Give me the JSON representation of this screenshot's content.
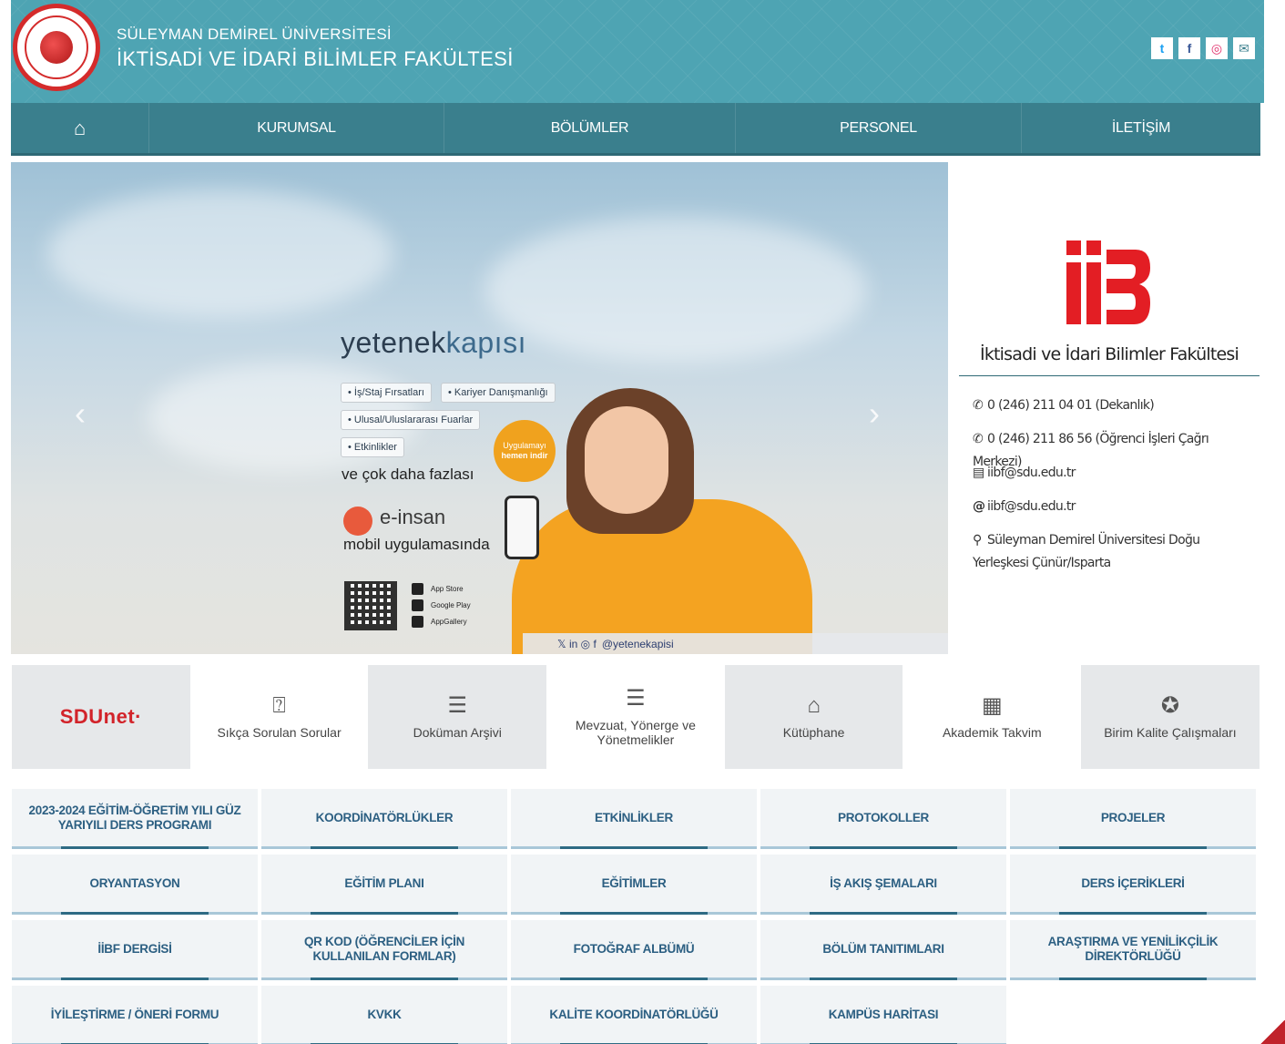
{
  "header": {
    "university": "SÜLEYMAN DEMİREL ÜNİVERSİTESİ",
    "faculty": "İKTİSADİ VE İDARİ BİLİMLER FAKÜLTESİ",
    "social": [
      {
        "icon": "twitter-icon",
        "glyph": "t",
        "color": "#1da1f2"
      },
      {
        "icon": "facebook-icon",
        "glyph": "f",
        "color": "#3b5998"
      },
      {
        "icon": "instagram-icon",
        "glyph": "◎",
        "color": "#e1306c"
      },
      {
        "icon": "mail-icon",
        "glyph": "✉",
        "color": "#3a7f8d"
      }
    ]
  },
  "nav": {
    "home_icon": "⌂",
    "items": [
      "KURUMSAL",
      "BÖLÜMLER",
      "PERSONEL",
      "İLETİŞİM"
    ]
  },
  "slider": {
    "prev": "‹",
    "next": "›",
    "brand_main": "yetenek",
    "brand_sub": "kapısı",
    "pills": [
      "• İş/Staj Fırsatları",
      "• Kariyer Danışmanlığı",
      "• Ulusal/Uluslararası Fuarlar",
      "• Etkinlikler"
    ],
    "more": "ve çok daha fazlası",
    "einsan": "e-insan",
    "mobile": "mobil uygulamasında",
    "download_1": "Uygulamayı",
    "download_2": "hemen indir",
    "stores": [
      "App Store",
      "Google Play",
      "AppGallery"
    ],
    "social_handle": "@yetenekapisi",
    "social_icons": "𝕏 in ◎ f"
  },
  "info": {
    "title": "İktisadi ve İdari Bilimler Fakültesi",
    "phone1": "0 (246) 211 04 01 (Dekanlık)",
    "phone2": "0 (246) 211 86 56 (Öğrenci İşleri Çağrı Merkezi)",
    "fax": "iibf@sdu.edu.tr",
    "email": "iibf@sdu.edu.tr",
    "address": "Süleyman Demirel Üniversitesi Doğu Yerleşkesi Çünür/Isparta"
  },
  "quick": {
    "sdunet": "SDUnet·",
    "items": [
      "Sıkça Sorulan Sorular",
      "Doküman Arşivi",
      "Mevzuat, Yönerge ve Yönetmelikler",
      "Kütüphane",
      "Akademik Takvim",
      "Birim Kalite Çalışmaları"
    ]
  },
  "grid": [
    "2023-2024 EĞİTİM-ÖĞRETİM YILI GÜZ YARIYILI DERS PROGRAMI",
    "KOORDİNATÖRLÜKLER",
    "ETKİNLİKLER",
    "PROTOKOLLER",
    "PROJELER",
    "ORYANTASYON",
    "EĞİTİM PLANI",
    "EĞİTİMLER",
    "İŞ AKIŞ ŞEMALARI",
    "DERS İÇERİKLERİ",
    "İİBF DERGİSİ",
    "QR KOD (ÖĞRENCİLER İÇİN KULLANILAN FORMLAR)",
    "FOTOĞRAF ALBÜMÜ",
    "BÖLÜM TANITIMLARI",
    "ARAŞTIRMA VE YENİLİKÇİLİK DİREKTÖRLÜĞÜ",
    "İYİLEŞTİRME / ÖNERİ FORMU",
    "KVKK",
    "KALİTE KOORDİNATÖRLÜĞÜ",
    "KAMPÜS HARİTASI"
  ]
}
